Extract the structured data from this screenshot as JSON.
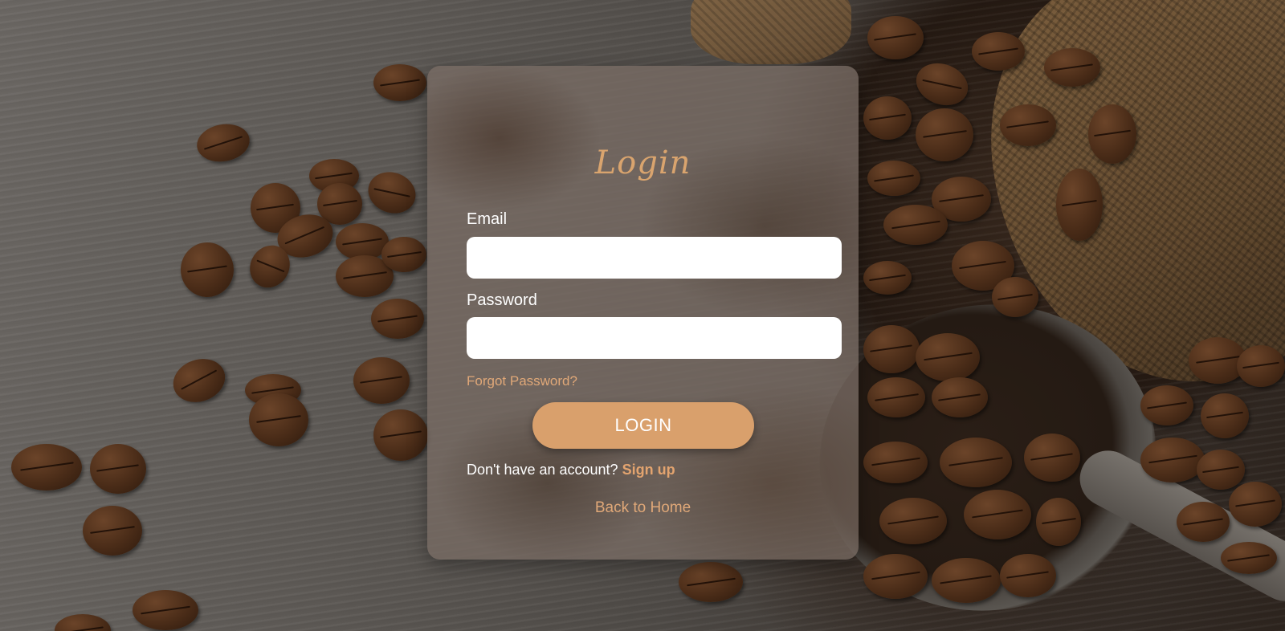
{
  "login": {
    "title": "Login",
    "email_label": "Email",
    "email_value": "",
    "password_label": "Password",
    "password_value": "",
    "forgot_password_label": "Forgot Password?",
    "login_button_label": "LOGIN",
    "signup_prompt": "Don't have an account?",
    "signup_link_label": "Sign up",
    "back_home_label": "Back to Home"
  },
  "colors": {
    "accent": "#d9a06c",
    "link": "#e0a878",
    "card_overlay": "rgba(120,108,100,0.78)"
  }
}
